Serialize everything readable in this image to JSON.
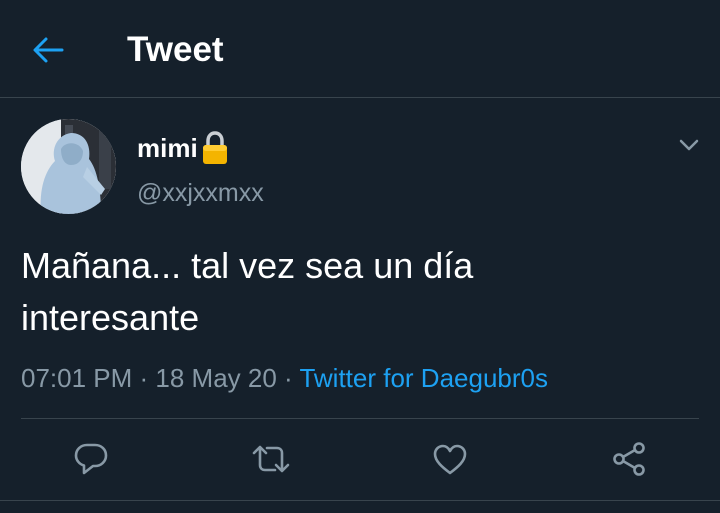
{
  "header": {
    "title": "Tweet",
    "back_icon": "arrow-left-icon"
  },
  "tweet": {
    "display_name": "mimi",
    "protected_icon": "lock-icon",
    "handle": "@xxjxxmxx",
    "text_line1": "Mañana... tal vez sea un día",
    "text_line2": "interesante",
    "time": "07:01 PM",
    "separator": " · ",
    "date": "18 May 20",
    "source": "Twitter for Daegubr0s"
  },
  "actions": {
    "reply_icon": "reply-icon",
    "retweet_icon": "retweet-icon",
    "like_icon": "heart-icon",
    "share_icon": "share-icon"
  },
  "colors": {
    "background": "#15202b",
    "accent": "#1da1f2",
    "secondary_text": "#8899a6",
    "divider": "#38444d"
  }
}
